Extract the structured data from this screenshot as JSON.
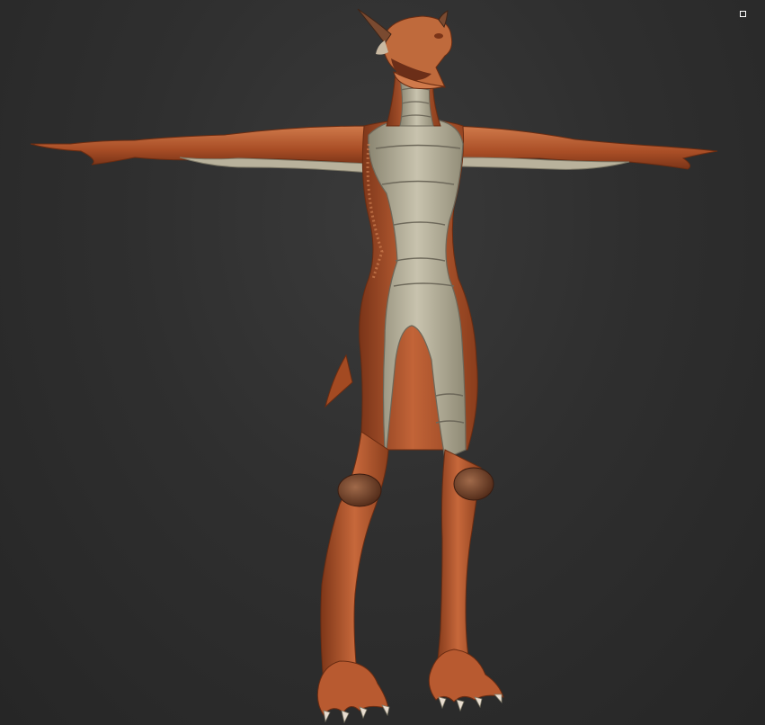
{
  "viewport": {
    "background": "#2b2b2b",
    "widgets": [
      {
        "name": "viewport-corner-widget",
        "color": "#ffffff"
      }
    ]
  },
  "model": {
    "subject": "dragon-creature",
    "colors": {
      "skin": "#b85a30",
      "skin_dark": "#7a3418",
      "skin_light": "#d9804f",
      "belly": "#b8b3a0",
      "belly_dark": "#7f7a68",
      "claw": "#e8ddd0"
    }
  }
}
